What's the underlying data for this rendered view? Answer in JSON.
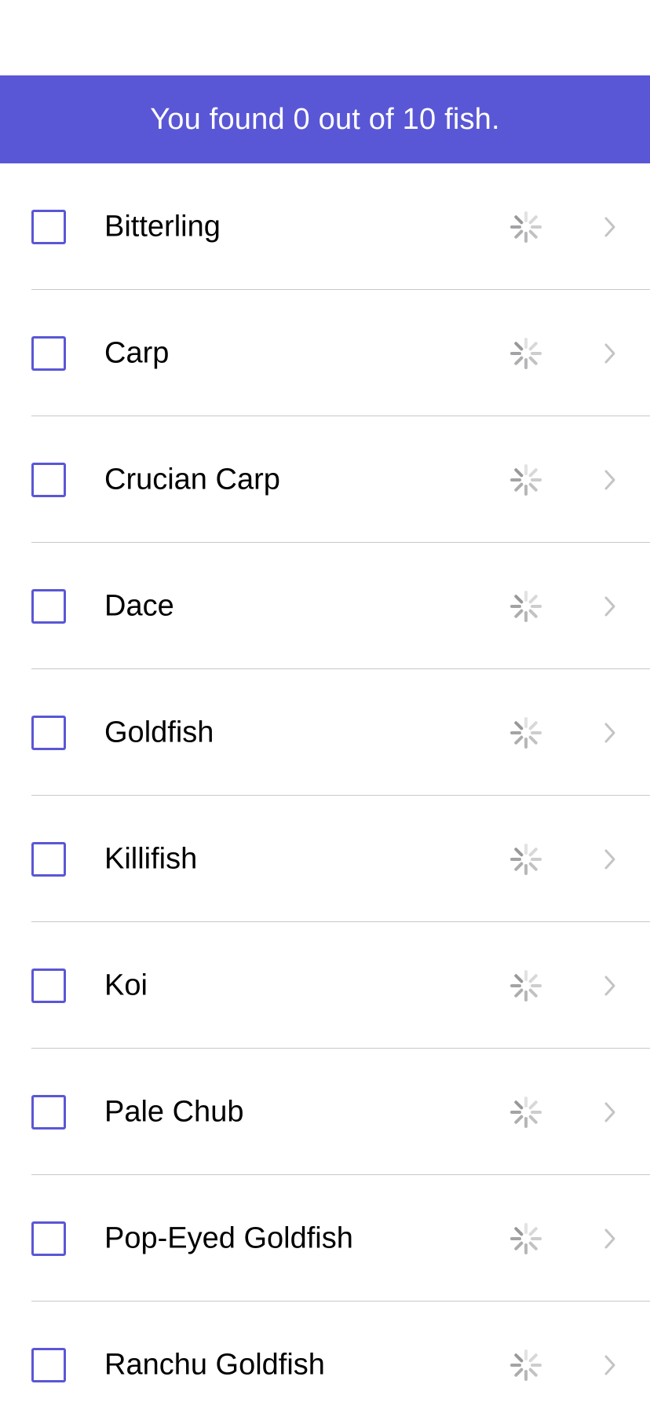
{
  "banner": {
    "text": "You found 0 out of 10 fish."
  },
  "theme": {
    "accent": "#5a57d6",
    "separator": "#c8c8cc",
    "chevron": "#c4c4c7",
    "spinner": "#8e8e93"
  },
  "fish": [
    {
      "name": "Bitterling",
      "checked": false,
      "status_icon": "loading-spinner-icon",
      "accessory_icon": "chevron-right-icon"
    },
    {
      "name": "Carp",
      "checked": false,
      "status_icon": "loading-spinner-icon",
      "accessory_icon": "chevron-right-icon"
    },
    {
      "name": "Crucian Carp",
      "checked": false,
      "status_icon": "loading-spinner-icon",
      "accessory_icon": "chevron-right-icon"
    },
    {
      "name": "Dace",
      "checked": false,
      "status_icon": "loading-spinner-icon",
      "accessory_icon": "chevron-right-icon"
    },
    {
      "name": "Goldfish",
      "checked": false,
      "status_icon": "loading-spinner-icon",
      "accessory_icon": "chevron-right-icon"
    },
    {
      "name": "Killifish",
      "checked": false,
      "status_icon": "loading-spinner-icon",
      "accessory_icon": "chevron-right-icon"
    },
    {
      "name": "Koi",
      "checked": false,
      "status_icon": "loading-spinner-icon",
      "accessory_icon": "chevron-right-icon"
    },
    {
      "name": "Pale Chub",
      "checked": false,
      "status_icon": "loading-spinner-icon",
      "accessory_icon": "chevron-right-icon"
    },
    {
      "name": "Pop-Eyed Goldfish",
      "checked": false,
      "status_icon": "loading-spinner-icon",
      "accessory_icon": "chevron-right-icon"
    },
    {
      "name": "Ranchu Goldfish",
      "checked": false,
      "status_icon": "loading-spinner-icon",
      "accessory_icon": "chevron-right-icon"
    }
  ]
}
